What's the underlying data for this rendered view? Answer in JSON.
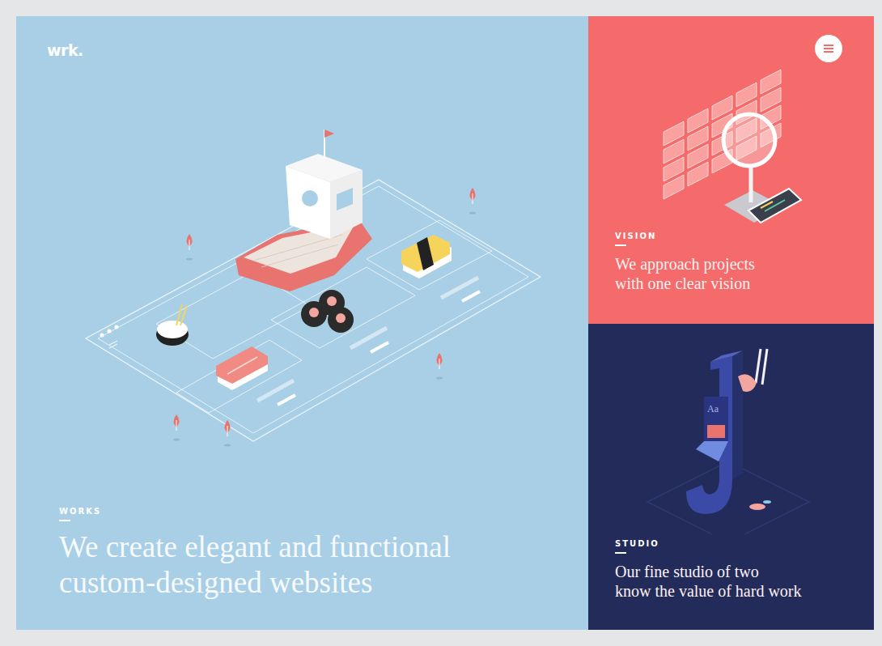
{
  "brand": {
    "logo": "wrk."
  },
  "panels": [
    {
      "kind": "works",
      "label": "WORKS",
      "lines": [
        "We create elegant and functional",
        "custom-designed websites"
      ]
    },
    {
      "kind": "vision",
      "label": "VISION",
      "lines": [
        "We approach projects",
        "with one clear vision"
      ]
    },
    {
      "kind": "studio",
      "label": "STUDIO",
      "lines": [
        "Our fine studio of two",
        "know the value of hard work"
      ],
      "illustration_text": "Aa"
    }
  ]
}
